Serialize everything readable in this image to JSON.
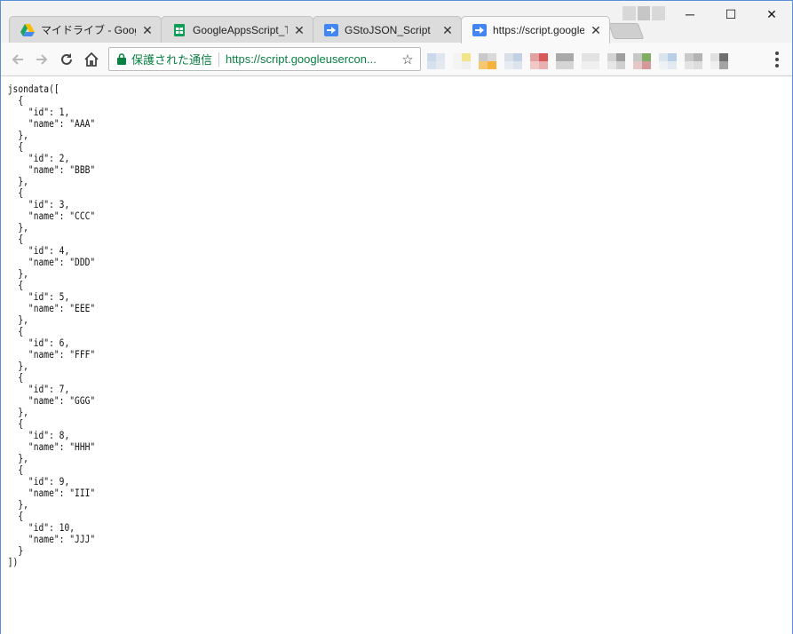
{
  "tabs": [
    {
      "title": "マイドライブ - Google ドライブ",
      "close": "✕",
      "icon": "google-drive-icon"
    },
    {
      "title": "GoogleAppsScript_Test",
      "close": "✕",
      "icon": "google-sheets-icon"
    },
    {
      "title": "GStoJSON_Script",
      "close": "✕",
      "icon": "apps-script-icon"
    },
    {
      "title": "https://script.googleusercontent.com",
      "close": "✕",
      "icon": "apps-script-icon"
    }
  ],
  "window_controls": {
    "minimize": "─",
    "maximize": "☐",
    "close": "✕"
  },
  "toolbar": {
    "back": "←",
    "forward": "→",
    "reload": "↻",
    "home": "⌂",
    "secure_label": "保護された通信",
    "url": "https://script.googleusercon...",
    "star": "☆"
  },
  "content": {
    "text": "jsondata([\n  {\n    \"id\": 1,\n    \"name\": \"AAA\"\n  },\n  {\n    \"id\": 2,\n    \"name\": \"BBB\"\n  },\n  {\n    \"id\": 3,\n    \"name\": \"CCC\"\n  },\n  {\n    \"id\": 4,\n    \"name\": \"DDD\"\n  },\n  {\n    \"id\": 5,\n    \"name\": \"EEE\"\n  },\n  {\n    \"id\": 6,\n    \"name\": \"FFF\"\n  },\n  {\n    \"id\": 7,\n    \"name\": \"GGG\"\n  },\n  {\n    \"id\": 8,\n    \"name\": \"HHH\"\n  },\n  {\n    \"id\": 9,\n    \"name\": \"III\"\n  },\n  {\n    \"id\": 10,\n    \"name\": \"JJJ\"\n  }\n])"
  },
  "colors": {
    "secure_green": "#0b8043",
    "window_border": "#5a8ed8"
  }
}
